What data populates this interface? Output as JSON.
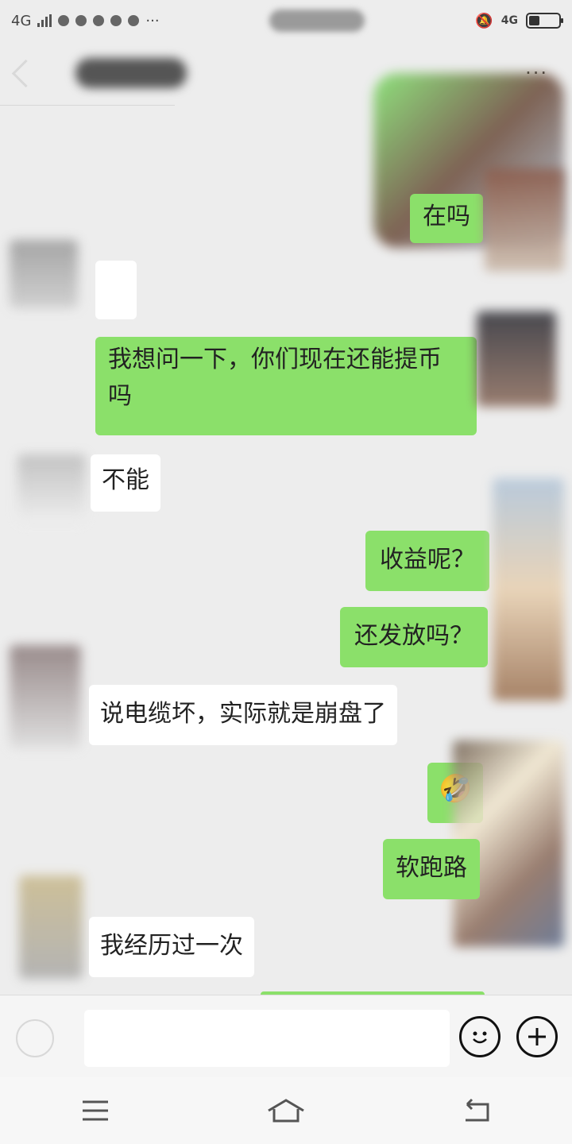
{
  "status_bar": {
    "network_left": "4G",
    "network_right": "4G",
    "icons": [
      "signal-icon",
      "weibo-icon",
      "qq-icon",
      "missed-call-icon",
      "wechat-icon",
      "browser-icon",
      "more-dots-icon",
      "mute-icon",
      "battery-icon"
    ],
    "battery_level": 0.35
  },
  "header": {
    "more_label": "···"
  },
  "messages": [
    {
      "side": "right",
      "text": "在吗"
    },
    {
      "side": "left",
      "text": ""
    },
    {
      "side": "right",
      "text": "我想问一下，你们现在还能提币吗"
    },
    {
      "side": "left",
      "text": "不能"
    },
    {
      "side": "right",
      "text": "收益呢？"
    },
    {
      "side": "right",
      "text": "还发放吗？"
    },
    {
      "side": "left",
      "text": "说电缆坏，实际就是崩盘了"
    },
    {
      "side": "right",
      "text": "🤣"
    },
    {
      "side": "right",
      "text": "软跑路"
    },
    {
      "side": "left",
      "text": "我经历过一次"
    }
  ],
  "input": {
    "placeholder": ""
  },
  "colors": {
    "sent_bubble": "#8be06a",
    "received_bubble": "#ffffff",
    "background": "#ededed"
  }
}
